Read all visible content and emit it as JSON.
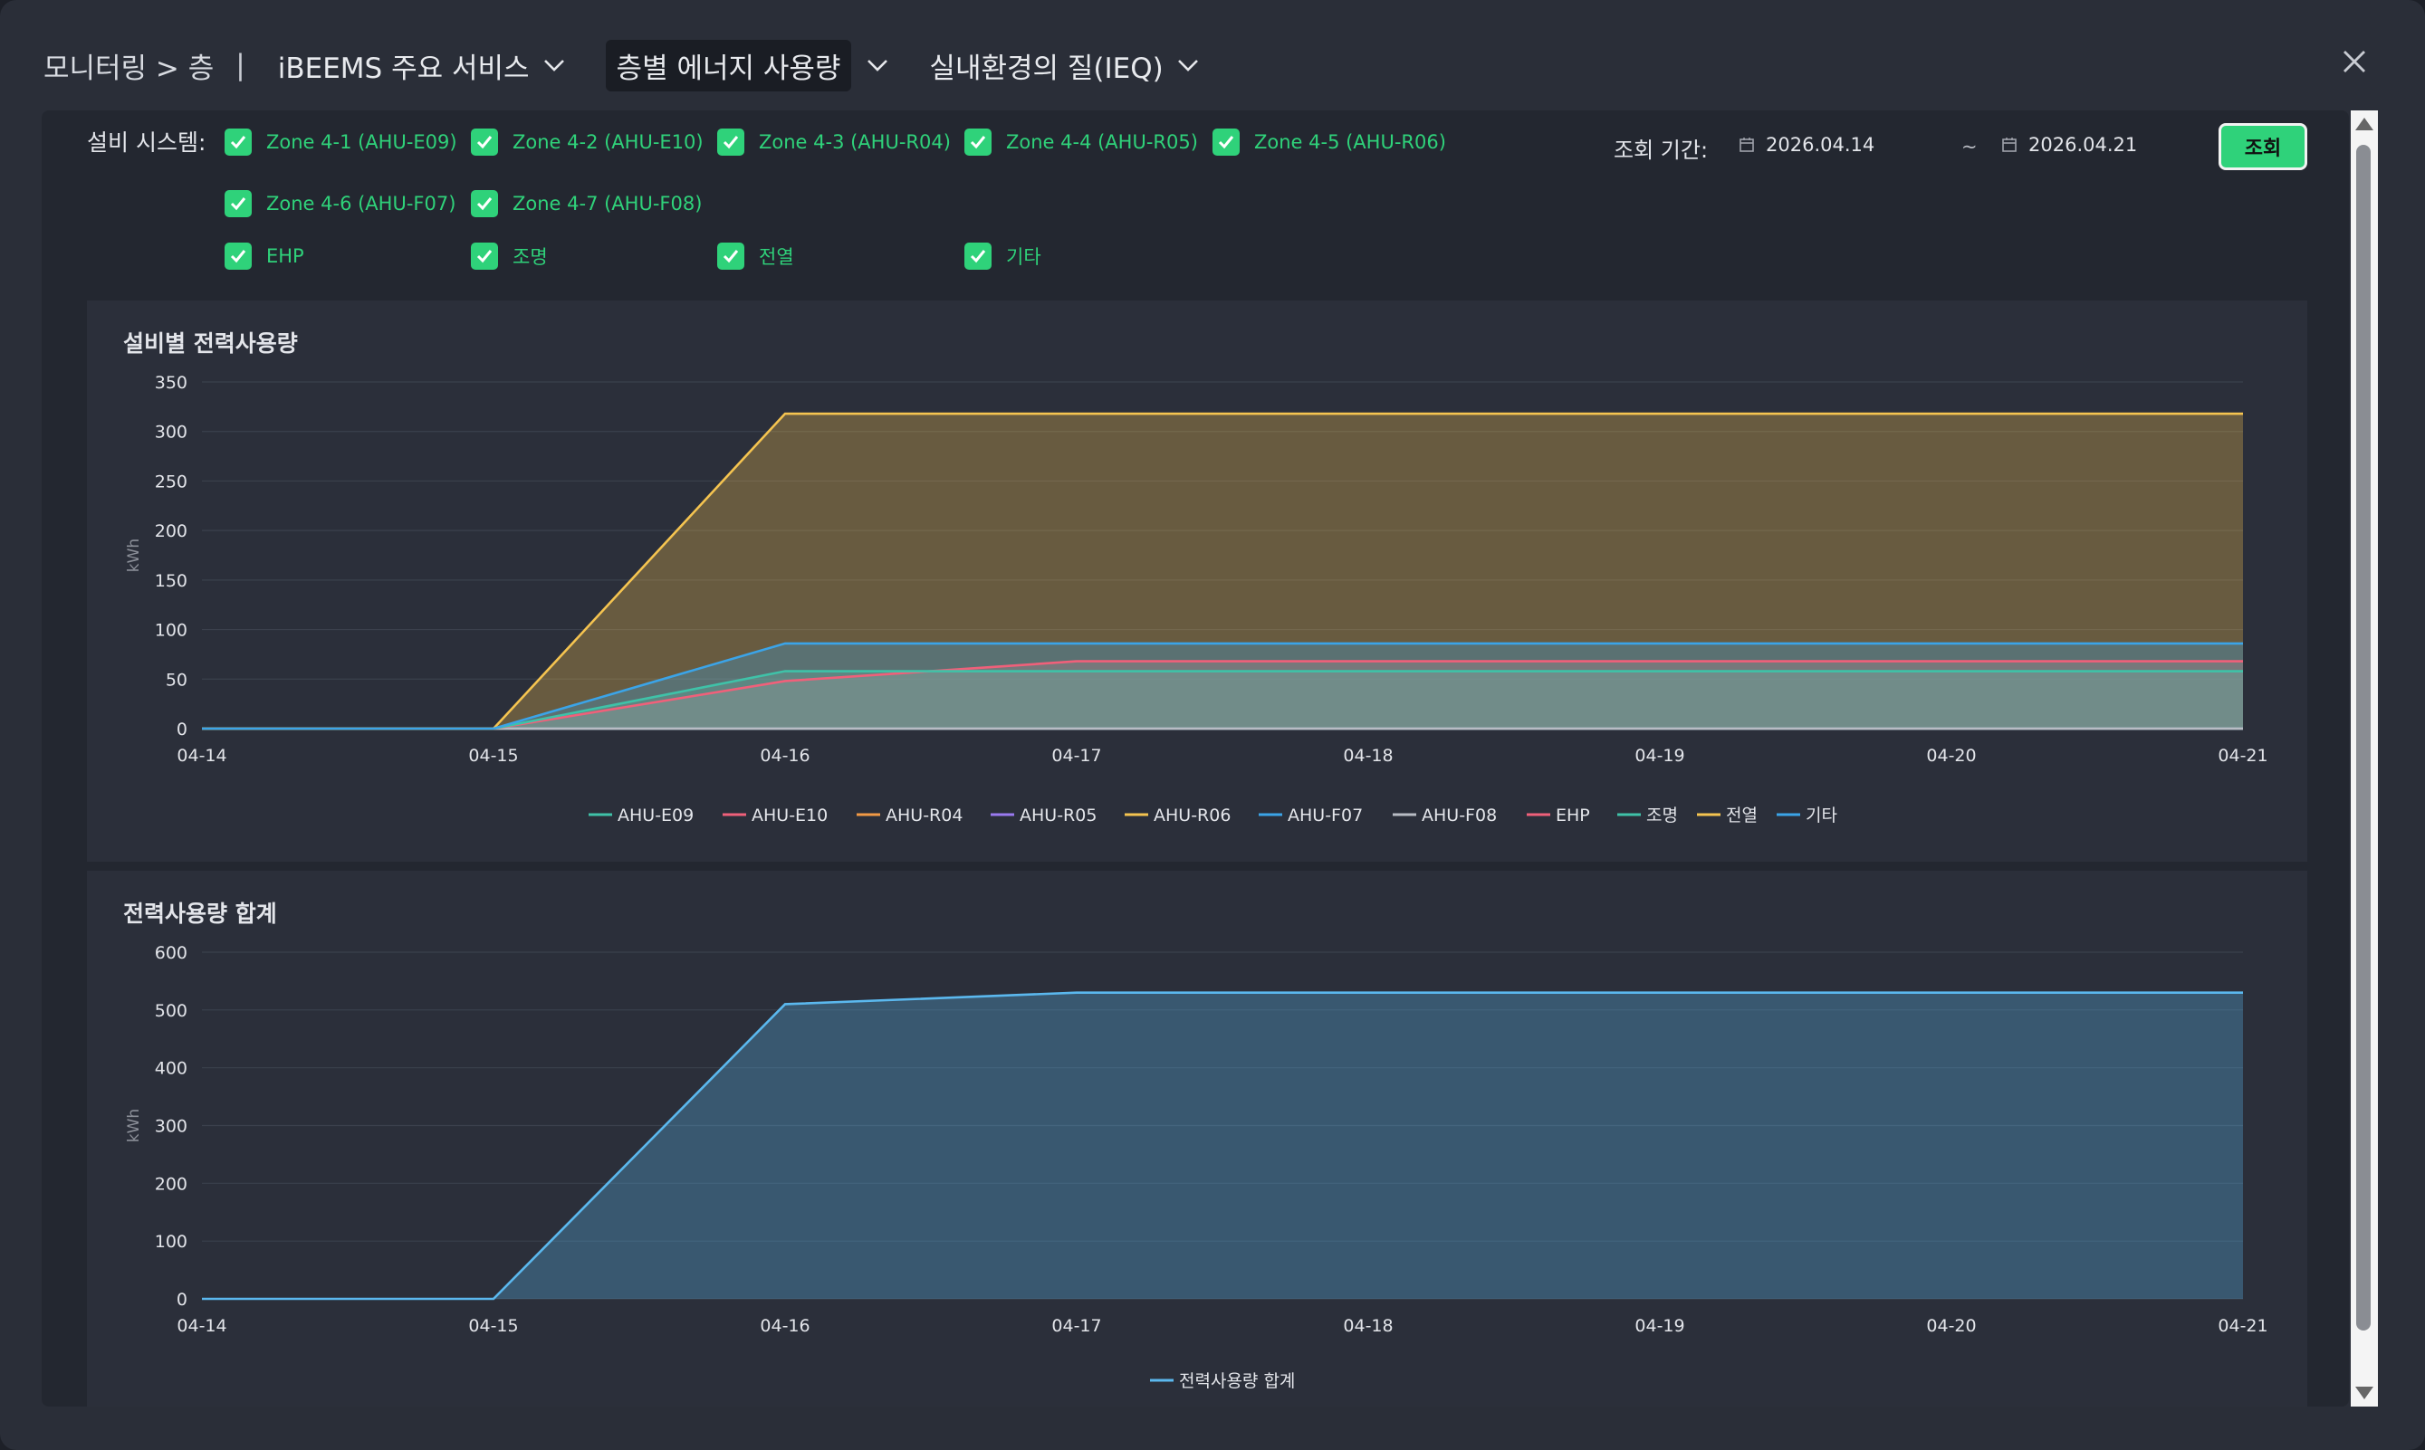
{
  "header": {
    "breadcrumb": "모니터링 > 층",
    "separator": "|",
    "menus": [
      {
        "label": "iBEEMS 주요 서비스",
        "active": false
      },
      {
        "label": "층별 에너지 사용량",
        "active": true
      },
      {
        "label": "실내환경의 질(IEQ)",
        "active": false
      }
    ],
    "close_icon": "close-icon"
  },
  "filters": {
    "label": "설비 시스템:",
    "options": [
      {
        "label": "Zone 4-1 (AHU-E09)",
        "checked": true
      },
      {
        "label": "Zone 4-2 (AHU-E10)",
        "checked": true
      },
      {
        "label": "Zone 4-3 (AHU-R04)",
        "checked": true
      },
      {
        "label": "Zone 4-4 (AHU-R05)",
        "checked": true
      },
      {
        "label": "Zone 4-5 (AHU-R06)",
        "checked": true
      },
      {
        "label": "Zone 4-6 (AHU-F07)",
        "checked": true
      },
      {
        "label": "Zone 4-7 (AHU-F08)",
        "checked": true
      },
      {
        "label": "EHP",
        "checked": true
      },
      {
        "label": "조명",
        "checked": true
      },
      {
        "label": "전열",
        "checked": true
      },
      {
        "label": "기타",
        "checked": true
      }
    ],
    "accent": "#2fd27a"
  },
  "period": {
    "label": "조회 기간:",
    "start": "2026.04.14",
    "tilde": "~",
    "end": "2026.04.21",
    "search_label": "조회"
  },
  "chart_data": [
    {
      "type": "area",
      "title": "설비별 전력사용량",
      "ylabel": "kWh",
      "x": [
        "04-14",
        "04-15",
        "04-16",
        "04-17",
        "04-18",
        "04-19",
        "04-20",
        "04-21"
      ],
      "ylim": [
        0,
        350
      ],
      "yticks": [
        0,
        50,
        100,
        150,
        200,
        250,
        300,
        350
      ],
      "grid": true,
      "legend_position": "bottom",
      "series": [
        {
          "name": "AHU-E09",
          "color": "#3fc2a8",
          "values": [
            0,
            0,
            0,
            0,
            0,
            0,
            0,
            0
          ]
        },
        {
          "name": "AHU-E10",
          "color": "#f0607a",
          "values": [
            0,
            0,
            0,
            0,
            0,
            0,
            0,
            0
          ]
        },
        {
          "name": "AHU-R04",
          "color": "#f29a45",
          "values": [
            0,
            0,
            0,
            0,
            0,
            0,
            0,
            0
          ]
        },
        {
          "name": "AHU-R05",
          "color": "#9a7af0",
          "values": [
            0,
            0,
            0,
            0,
            0,
            0,
            0,
            0
          ]
        },
        {
          "name": "AHU-R06",
          "color": "#f5c450",
          "values": [
            0,
            0,
            0,
            0,
            0,
            0,
            0,
            0
          ]
        },
        {
          "name": "AHU-F07",
          "color": "#3ba4e8",
          "values": [
            0,
            0,
            0,
            0,
            0,
            0,
            0,
            0
          ]
        },
        {
          "name": "AHU-F08",
          "color": "#b8bcc4",
          "values": [
            0,
            0,
            0,
            0,
            0,
            0,
            0,
            0
          ]
        },
        {
          "name": "EHP",
          "color": "#f0607a",
          "values": [
            0,
            0,
            48,
            68,
            68,
            68,
            68,
            68
          ]
        },
        {
          "name": "조명",
          "color": "#3fc2a8",
          "values": [
            0,
            0,
            58,
            58,
            58,
            58,
            58,
            58
          ]
        },
        {
          "name": "전열",
          "color": "#f5c450",
          "values": [
            0,
            0,
            318,
            318,
            318,
            318,
            318,
            318
          ]
        },
        {
          "name": "기타",
          "color": "#3ba4e8",
          "values": [
            0,
            0,
            86,
            86,
            86,
            86,
            86,
            86
          ]
        }
      ]
    },
    {
      "type": "area",
      "title": "전력사용량 합계",
      "ylabel": "kWh",
      "x": [
        "04-14",
        "04-15",
        "04-16",
        "04-17",
        "04-18",
        "04-19",
        "04-20",
        "04-21"
      ],
      "ylim": [
        0,
        600
      ],
      "yticks": [
        0,
        100,
        200,
        300,
        400,
        500,
        600
      ],
      "grid": true,
      "legend_position": "bottom",
      "series": [
        {
          "name": "전력사용량 합계",
          "color": "#5bb8ee",
          "values": [
            0,
            0,
            510,
            530,
            530,
            530,
            530,
            530
          ]
        }
      ]
    }
  ]
}
